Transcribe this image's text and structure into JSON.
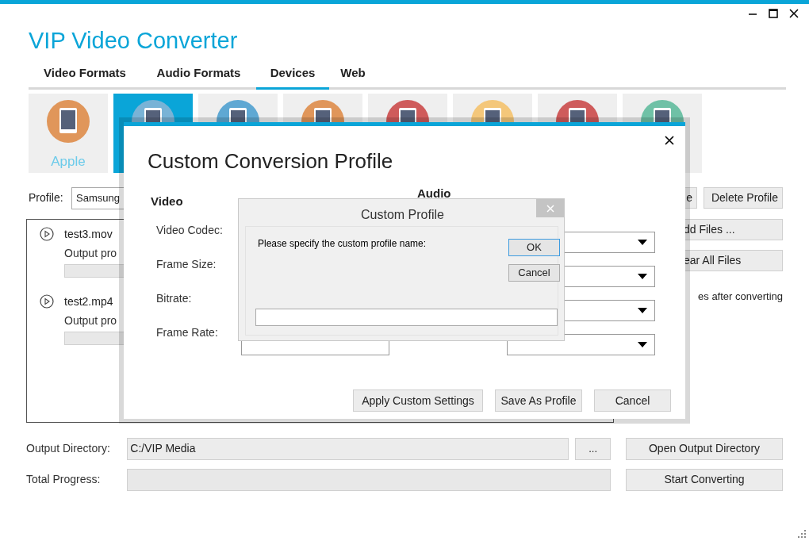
{
  "window": {
    "title": "VIP Video Converter"
  },
  "tabs": [
    {
      "label": "Video Formats",
      "selected": false
    },
    {
      "label": "Audio Formats",
      "selected": false
    },
    {
      "label": "Devices",
      "selected": true
    },
    {
      "label": "Web",
      "selected": false
    }
  ],
  "device_tiles": [
    {
      "label": "Apple",
      "selected": false,
      "color": "#e0965a"
    },
    {
      "selected": true,
      "color": "#79b3d6"
    },
    {
      "selected": false,
      "color": "#5fa8d3"
    },
    {
      "selected": false,
      "color": "#e0965a"
    },
    {
      "selected": false,
      "color": "#cf5b5b"
    },
    {
      "selected": false,
      "color": "#f4c77a"
    },
    {
      "selected": false,
      "color": "#cf5b5b"
    },
    {
      "selected": false,
      "color": "#6fc1a6"
    }
  ],
  "profile": {
    "label": "Profile:",
    "value": "Samsung"
  },
  "profile_buttons": [
    "e",
    "Delete Profile"
  ],
  "files": [
    {
      "name": "test3.mov",
      "output": "Output pro",
      "level": 0
    },
    {
      "name": "test2.mp4",
      "output": "Output pro",
      "level": 0
    }
  ],
  "side_buttons": [
    "dd Files ...",
    "ear All Files"
  ],
  "after_option": "es after converting",
  "output_directory": {
    "label": "Output Directory:",
    "value": "C:/VIP Media",
    "browse": "...",
    "button": "Open Output Directory"
  },
  "total_progress": {
    "label": "Total Progress:",
    "level": 0,
    "button": "Start Converting"
  },
  "conversion_dialog": {
    "title": "Custom Conversion Profile",
    "video_heading": "Video",
    "audio_heading": "Audio",
    "video_fields": [
      "Video Codec:",
      "Frame Size:",
      "Bitrate:",
      "Frame Rate:"
    ],
    "audio_fields": [
      {
        "kind": "dropdown"
      },
      {
        "kind": "dropdown"
      },
      {
        "kind": "dropdown"
      },
      {
        "kind": "dropdown"
      }
    ],
    "buttons": [
      "Apply Custom Settings",
      "Save As Profile",
      "Cancel"
    ]
  },
  "profile_dialog": {
    "title": "Custom Profile",
    "prompt": "Please specify the custom profile name:",
    "buttons": [
      {
        "label": "OK",
        "default": true
      },
      {
        "label": "Cancel",
        "default": false
      }
    ]
  }
}
